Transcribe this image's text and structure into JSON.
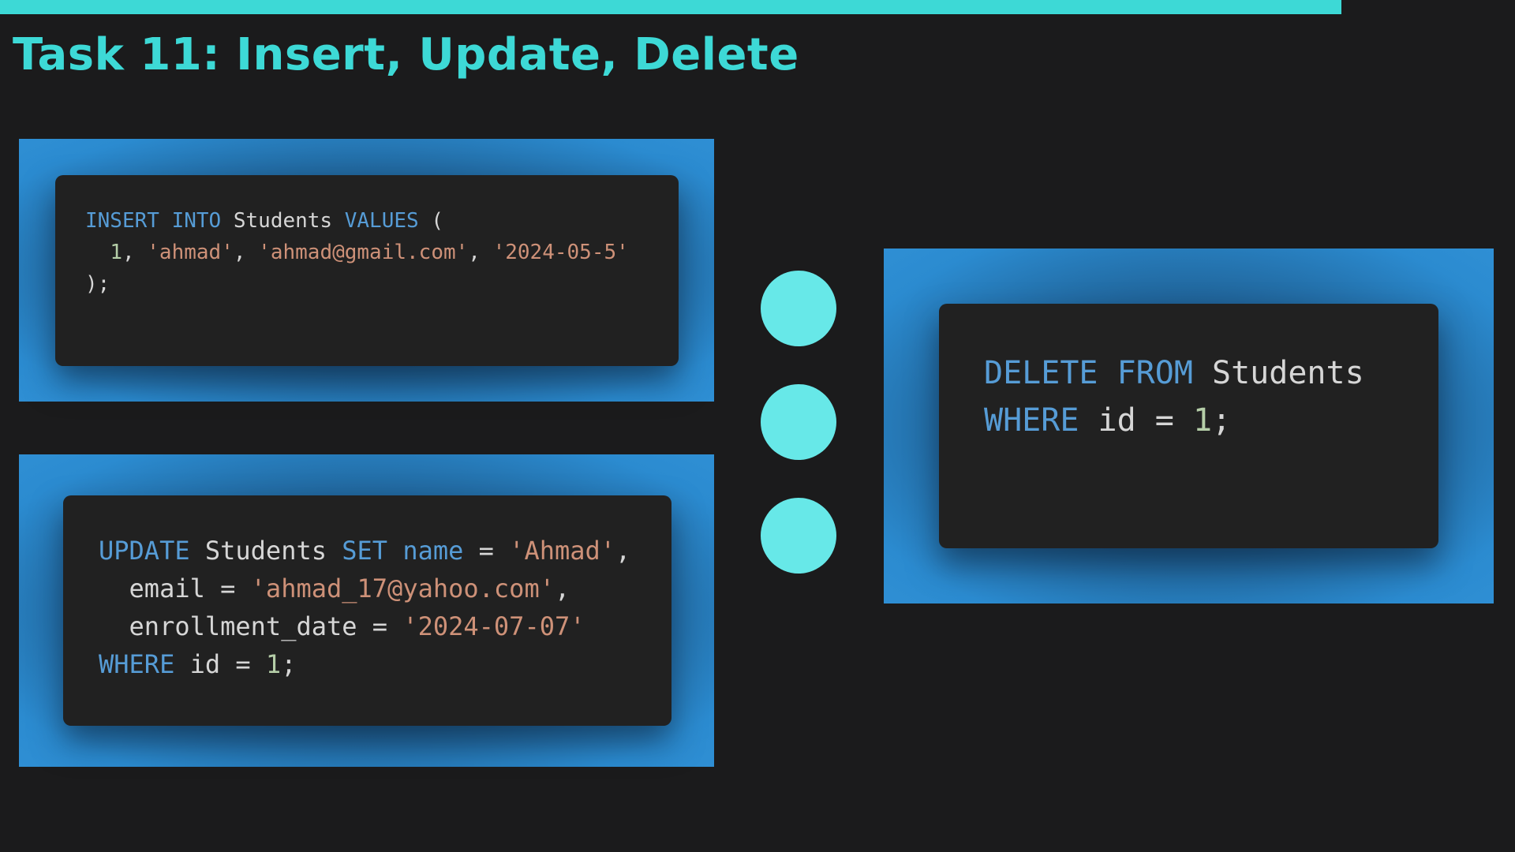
{
  "title": "Task 11: Insert, Update, Delete",
  "colors": {
    "accent": "#3dd9d6",
    "dot": "#67e8e8",
    "panel_blue": "#2b8bd0",
    "card_bg": "#212121",
    "page_bg": "#1b1b1c",
    "keyword": "#569cd6",
    "string": "#ce9178",
    "number": "#b5cea8",
    "plain": "#d6d6d6"
  },
  "insert": {
    "kw_insert": "INSERT",
    "kw_into": "INTO",
    "table": "Students",
    "kw_values": "VALUES",
    "open_paren": "(",
    "id": "1",
    "name": "'ahmad'",
    "email": "'ahmad@gmail.com'",
    "date": "'2024-05-5'",
    "close": ");"
  },
  "update": {
    "kw_update": "UPDATE",
    "table": "Students",
    "kw_set": "SET",
    "col_name": "name",
    "name_value": "'Ahmad'",
    "col_email": "email",
    "email_value": "'ahmad_17@yahoo.com'",
    "col_date": "enrollment_date",
    "date_value": "'2024-07-07'",
    "kw_where": "WHERE",
    "col_id": "id",
    "id_value": "1",
    "end": ";"
  },
  "delete": {
    "kw_delete": "DELETE",
    "kw_from": "FROM",
    "table": "Students",
    "kw_where": "WHERE",
    "col_id": "id",
    "id_value": "1",
    "end": ";"
  }
}
